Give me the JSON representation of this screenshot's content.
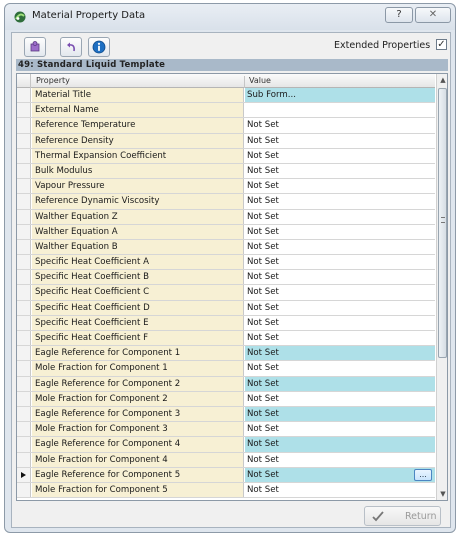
{
  "window": {
    "title": "Material Property Data",
    "help_label": "?",
    "close_label": "✕"
  },
  "toolbar": {
    "extended_properties_label": "Extended Properties",
    "extended_properties_checked": true,
    "check_glyph": "✓"
  },
  "template_header": "49: Standard Liquid Template",
  "grid": {
    "columns": {
      "property": "Property",
      "value": "Value"
    },
    "rows": [
      {
        "property": "Material Title",
        "value": "Sub Form...",
        "highlight": true
      },
      {
        "property": "External Name",
        "value": "",
        "highlight": false
      },
      {
        "property": "Reference Temperature",
        "value": "Not Set",
        "highlight": false
      },
      {
        "property": "Reference Density",
        "value": "Not Set",
        "highlight": false
      },
      {
        "property": "Thermal Expansion Coefficient",
        "value": "Not Set",
        "highlight": false
      },
      {
        "property": "Bulk Modulus",
        "value": "Not Set",
        "highlight": false
      },
      {
        "property": "Vapour Pressure",
        "value": "Not Set",
        "highlight": false
      },
      {
        "property": "Reference Dynamic Viscosity",
        "value": "Not Set",
        "highlight": false
      },
      {
        "property": "Walther Equation Z",
        "value": "Not Set",
        "highlight": false
      },
      {
        "property": "Walther Equation A",
        "value": "Not Set",
        "highlight": false
      },
      {
        "property": "Walther Equation B",
        "value": "Not Set",
        "highlight": false
      },
      {
        "property": "Specific Heat Coefficient A",
        "value": "Not Set",
        "highlight": false
      },
      {
        "property": "Specific Heat Coefficient B",
        "value": "Not Set",
        "highlight": false
      },
      {
        "property": "Specific Heat Coefficient C",
        "value": "Not Set",
        "highlight": false
      },
      {
        "property": "Specific Heat Coefficient D",
        "value": "Not Set",
        "highlight": false
      },
      {
        "property": "Specific Heat Coefficient E",
        "value": "Not Set",
        "highlight": false
      },
      {
        "property": "Specific Heat Coefficient F",
        "value": "Not Set",
        "highlight": false
      },
      {
        "property": "Eagle Reference for Component 1",
        "value": "Not Set",
        "highlight": true
      },
      {
        "property": "Mole Fraction for Component 1",
        "value": "Not Set",
        "highlight": false
      },
      {
        "property": "Eagle Reference for Component 2",
        "value": "Not Set",
        "highlight": true
      },
      {
        "property": "Mole Fraction for Component 2",
        "value": "Not Set",
        "highlight": false
      },
      {
        "property": "Eagle Reference for Component 3",
        "value": "Not Set",
        "highlight": true
      },
      {
        "property": "Mole Fraction for Component 3",
        "value": "Not Set",
        "highlight": false
      },
      {
        "property": "Eagle Reference for Component 4",
        "value": "Not Set",
        "highlight": true
      },
      {
        "property": "Mole Fraction for Component 4",
        "value": "Not Set",
        "highlight": false
      },
      {
        "property": "Eagle Reference for Component 5",
        "value": "Not Set",
        "highlight": true,
        "current": true
      },
      {
        "property": "Mole Fraction for Component 5",
        "value": "Not Set",
        "highlight": false
      }
    ],
    "ellipsis_label": "..."
  },
  "footer": {
    "return_label": "Return"
  },
  "colors": {
    "property_cell": "#f7f0d4",
    "highlight_value": "#aee0e8",
    "template_header": "#a9b9c9"
  }
}
